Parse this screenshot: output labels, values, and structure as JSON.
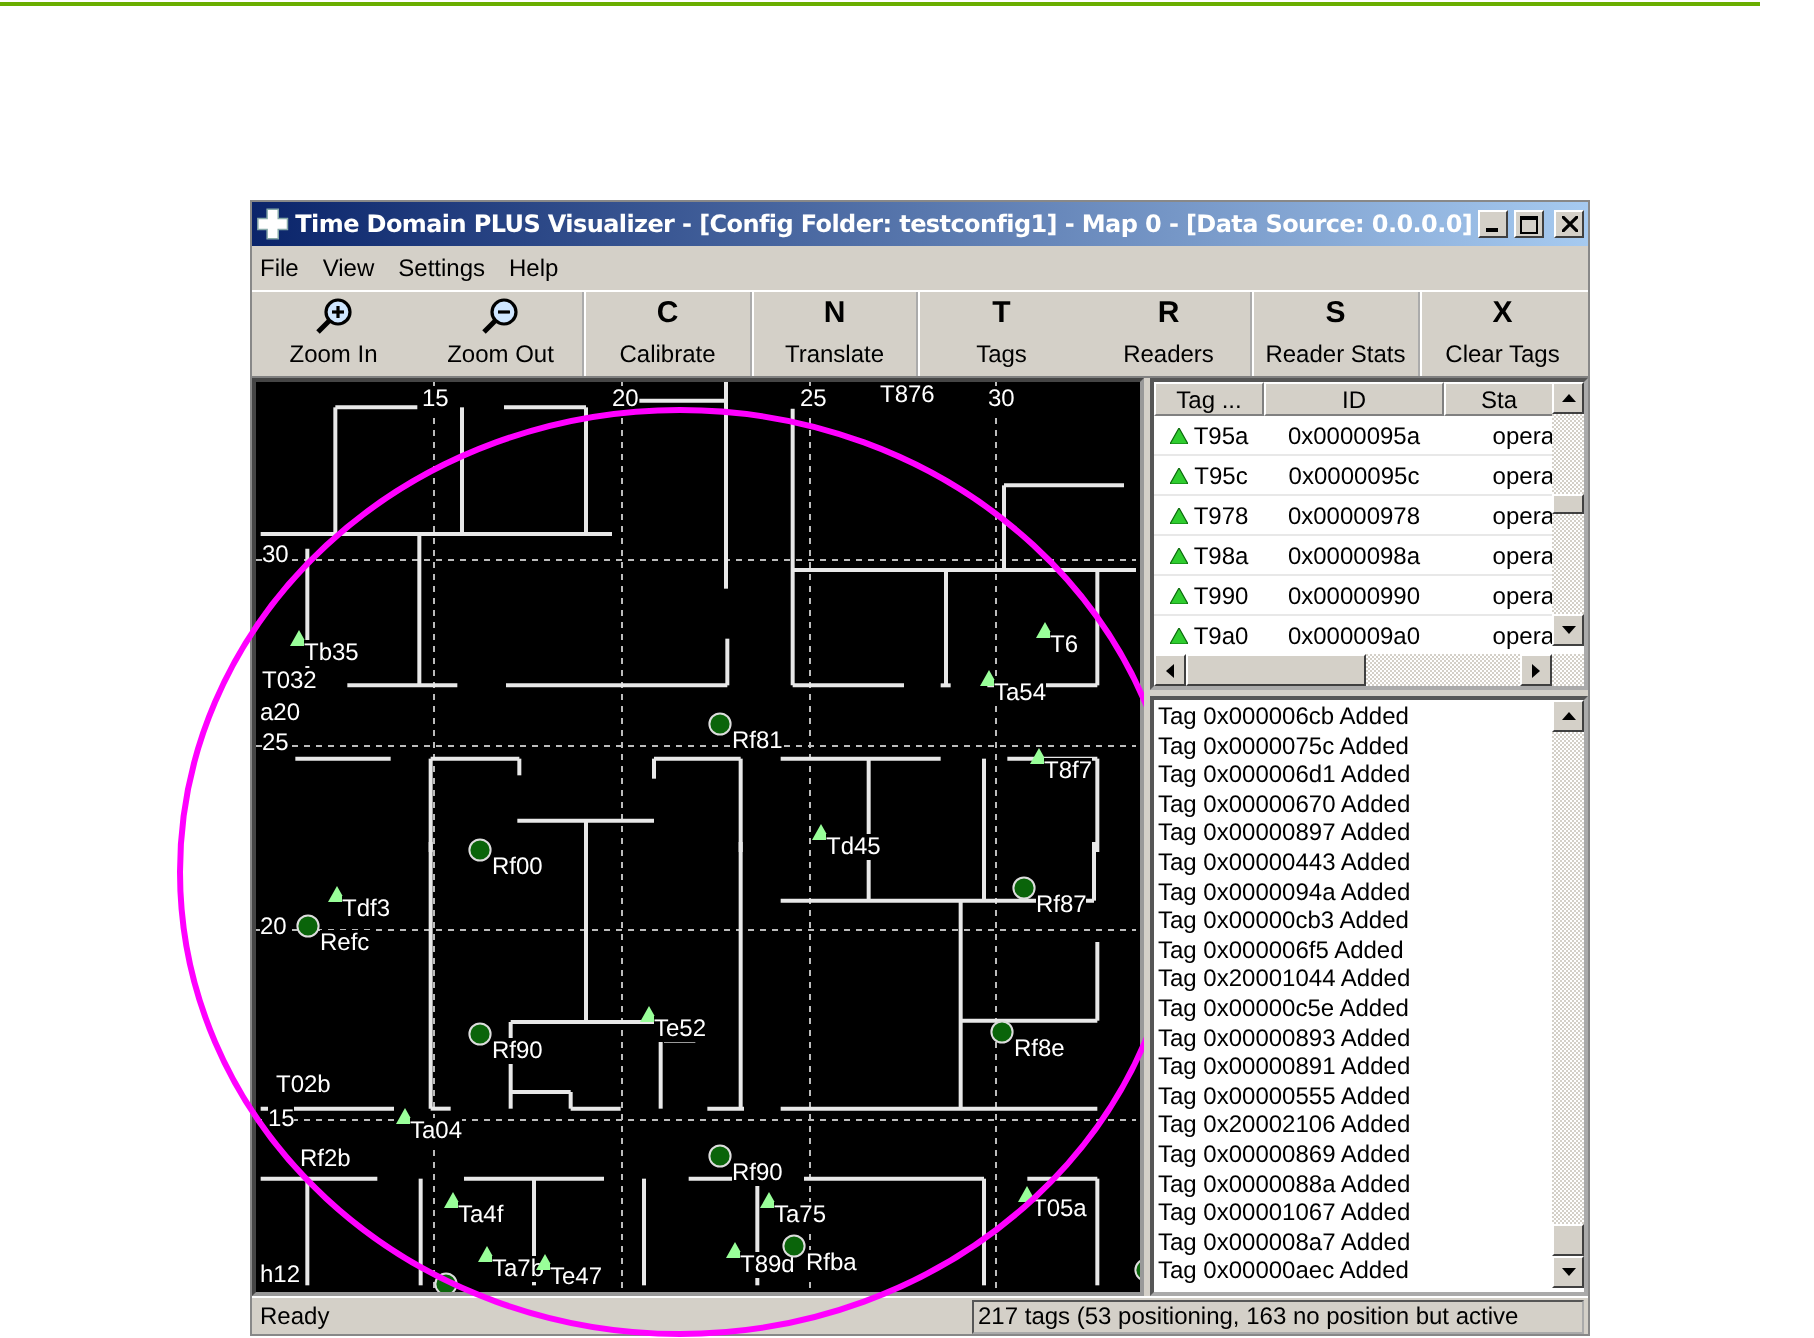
{
  "window": {
    "title": "Time Domain PLUS Visualizer - [Config Folder: testconfig1] - Map 0 - [Data Source:  0.0.0.0]"
  },
  "menu": [
    "File",
    "View",
    "Settings",
    "Help"
  ],
  "toolbar": [
    {
      "kind": "zoom-in",
      "label": "Zoom In",
      "separator": false
    },
    {
      "kind": "zoom-out",
      "label": "Zoom Out",
      "separator": true
    },
    {
      "kind": "letter",
      "key": "C",
      "label": "Calibrate",
      "separator": true
    },
    {
      "kind": "letter",
      "key": "N",
      "label": "Translate",
      "separator": true
    },
    {
      "kind": "letter",
      "key": "T",
      "label": "Tags",
      "separator": false
    },
    {
      "kind": "letter",
      "key": "R",
      "label": "Readers",
      "separator": true
    },
    {
      "kind": "letter",
      "key": "S",
      "label": "Reader Stats",
      "separator": true
    },
    {
      "kind": "letter",
      "key": "X",
      "label": "Clear Tags",
      "separator": false
    }
  ],
  "map": {
    "grid_labels": [
      "15",
      "20",
      "25",
      "30",
      "30",
      "25",
      "20",
      "15"
    ],
    "markers": [
      {
        "kind": "tag",
        "label": "Tb35"
      },
      {
        "kind": "label",
        "label": "T032"
      },
      {
        "kind": "label",
        "label": "a20"
      },
      {
        "kind": "label",
        "label": "T876"
      },
      {
        "kind": "tag",
        "label": "Ta54"
      },
      {
        "kind": "tag",
        "label": "T6"
      },
      {
        "kind": "reader",
        "label": "Rf81"
      },
      {
        "kind": "tag",
        "label": "T8f7"
      },
      {
        "kind": "tag",
        "label": "Td45"
      },
      {
        "kind": "reader",
        "label": "Rf00"
      },
      {
        "kind": "reader",
        "label": "Refc"
      },
      {
        "kind": "tag",
        "label": "Tdf3"
      },
      {
        "kind": "reader",
        "label": "Rf87"
      },
      {
        "kind": "reader",
        "label": "Rf90"
      },
      {
        "kind": "tag",
        "label": "Te52"
      },
      {
        "kind": "reader",
        "label": "Rf8e"
      },
      {
        "kind": "label",
        "label": "T02b"
      },
      {
        "kind": "tag",
        "label": "Ta04"
      },
      {
        "kind": "label",
        "label": "Rf2b"
      },
      {
        "kind": "reader",
        "label": "Rf90"
      },
      {
        "kind": "tag",
        "label": "Ta4f"
      },
      {
        "kind": "tag",
        "label": "Ta75"
      },
      {
        "kind": "tag",
        "label": "T05a"
      },
      {
        "kind": "tag",
        "label": "Ta7b"
      },
      {
        "kind": "tag",
        "label": "Te47"
      },
      {
        "kind": "tag",
        "label": "T89d"
      },
      {
        "kind": "reader",
        "label": "Rfba"
      },
      {
        "kind": "reader"
      },
      {
        "kind": "reader"
      },
      {
        "kind": "label",
        "label": "h12"
      }
    ]
  },
  "tag_table": {
    "columns": [
      "Tag ...",
      "ID",
      "Sta"
    ],
    "rows": [
      {
        "tag": "T95a",
        "id": "0x0000095a",
        "status": "opera"
      },
      {
        "tag": "T95c",
        "id": "0x0000095c",
        "status": "opera"
      },
      {
        "tag": "T978",
        "id": "0x00000978",
        "status": "opera"
      },
      {
        "tag": "T98a",
        "id": "0x0000098a",
        "status": "opera"
      },
      {
        "tag": "T990",
        "id": "0x00000990",
        "status": "opera"
      },
      {
        "tag": "T9a0",
        "id": "0x000009a0",
        "status": "opera"
      }
    ]
  },
  "log": [
    "Tag 0x000006cb Added",
    "Tag 0x0000075c Added",
    "Tag 0x000006d1 Added",
    "Tag 0x00000670 Added",
    "Tag 0x00000897 Added",
    "Tag 0x00000443 Added",
    "Tag 0x0000094a Added",
    "Tag 0x00000cb3 Added",
    "Tag 0x000006f5 Added",
    "Tag 0x20001044 Added",
    "Tag 0x00000c5e Added",
    "Tag 0x00000893 Added",
    "Tag 0x00000891 Added",
    "Tag 0x00000555 Added",
    "Tag 0x20002106 Added",
    "Tag 0x00000869 Added",
    "Tag 0x0000088a Added",
    "Tag 0x00001067 Added",
    "Tag 0x000008a7 Added",
    "Tag 0x00000aec Added"
  ],
  "status_bar": {
    "left": "Ready",
    "right": "217 tags (53 positioning, 163 no position but active"
  }
}
